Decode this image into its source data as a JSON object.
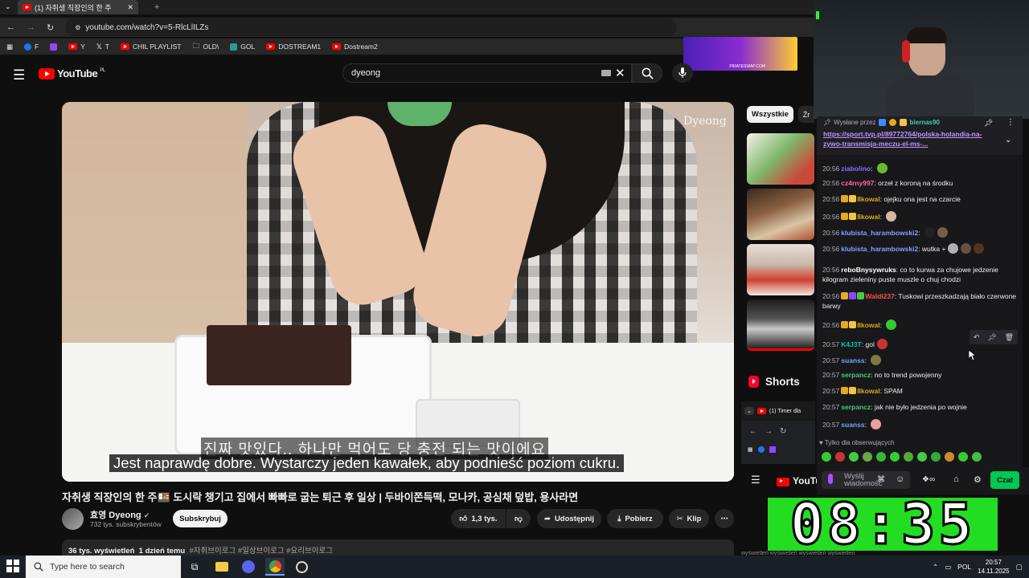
{
  "browser": {
    "tab_title": "(1) 자취생 직장인의 한 주",
    "url": "youtube.com/watch?v=5-RlcLlILZs",
    "bookmarks": [
      {
        "label": "F",
        "color": "#1877f2"
      },
      {
        "label": "",
        "color": "#9146ff"
      },
      {
        "label": "Y",
        "color": "#ff0000"
      },
      {
        "label": "T",
        "color": "#ffffff"
      },
      {
        "label": "CHIL PLAYLIST",
        "color": "#ff0000"
      },
      {
        "label": "OLD\\",
        "color": "#e3e3e3"
      },
      {
        "label": "GOL",
        "color": "#2a9d8f"
      },
      {
        "label": "DOSTREAM1",
        "color": "#ff0000"
      },
      {
        "label": "Dostream2",
        "color": "#ff0000"
      }
    ],
    "ad_text": "PIRATESWAP.COM"
  },
  "youtube": {
    "logo_text": "YouTube",
    "region": "PL",
    "search_value": "dyeong",
    "video": {
      "watermark": "Dyeong",
      "subtitle_ko": "진짜 맛있다.. 하나만 먹어도 당 충전 되는 맛이에요",
      "subtitle_pl": "Jest naprawdę dobre. Wystarczy jeden kawałek, aby podnieść poziom cukru.",
      "title": "자취생 직장인의 한 주🍱 도시락 챙기고 집에서 빠빠로 굽는 퇴근 후 일상 | 두바이쫀득떡, 모나카, 공심채 덮밥, 용사라면",
      "channel": "효영 Dyeong",
      "subscribers": "732 tys. subskrybentów",
      "subscribe_label": "Subskrybuj",
      "likes": "1,3 tys.",
      "share_label": "Udostępnij",
      "download_label": "Pobierz",
      "clip_label": "Klip",
      "views": "36 tys. wyświetleń",
      "date": "1 dzień temu",
      "hashtags": "#자취브이로그 #일상브이로그 #요리브이로그"
    },
    "chips": [
      "Wszystkie",
      "Źr"
    ],
    "shorts_label": "Shorts",
    "mini_tab": "(1) Timer dla"
  },
  "chat": {
    "pinned_by_prefix": "Wysłane przez",
    "pinned_by_user": "biernas90",
    "pinned_link": "https://sport.tvp.pl/89772764/polska-holandia-na-zywo-transmisja-meczu-el-ms-...",
    "messages": [
      {
        "time": "20:56",
        "user": "ziabolino",
        "color": "#8a6cff",
        "text": "",
        "badges": [],
        "emotes": [
          "#66bb33"
        ]
      },
      {
        "time": "20:56",
        "user": "cz4rny997",
        "color": "#ff6699",
        "text": "orzeł z koroną na środku",
        "badges": [],
        "emotes": []
      },
      {
        "time": "20:56",
        "user": "8kowal",
        "color": "#daa520",
        "text": "ojejku ona jest na czarcie",
        "badges": [
          "#e5a823",
          "#f4c542"
        ],
        "emotes": []
      },
      {
        "time": "20:56",
        "user": "8kowal",
        "color": "#daa520",
        "text": "",
        "badges": [
          "#e5a823",
          "#f4c542"
        ],
        "emotes": [
          "#d9b8a0"
        ]
      },
      {
        "time": "20:56",
        "user": "klubista_harambowski2",
        "color": "#8a9bff",
        "text": "",
        "badges": [],
        "emotes": [
          "#222222",
          "#7a5c4a"
        ]
      },
      {
        "time": "20:56",
        "user": "klubista_harambowski2",
        "color": "#8a9bff",
        "text": "wutka +",
        "badges": [],
        "emotes": [
          "#b0b0b0",
          "#6a5040",
          "#553322"
        ]
      },
      {
        "time": "20:56",
        "user": "reboBnysywruks",
        "color": "#ffffff",
        "text": "co to kurwa za chujowe jedzenie kilogram zieleniny puste muszle o chuj chodzi",
        "badges": [],
        "emotes": []
      },
      {
        "time": "20:56",
        "user": "Waldi237",
        "color": "#ff4f4f",
        "text": "Tuskowi przeszkadzają biało czerwone barwy",
        "badges": [
          "#e5a823",
          "#9146ff",
          "#44cc44"
        ],
        "emotes": []
      },
      {
        "time": "20:56",
        "user": "8kowal",
        "color": "#daa520",
        "text": "",
        "badges": [
          "#e5a823",
          "#f4c542"
        ],
        "emotes": [
          "#33cc33"
        ]
      },
      {
        "time": "20:57",
        "user": "K4J3T",
        "color": "#00c8a8",
        "text": "gol",
        "badges": [],
        "emotes": [
          "#cc3333"
        ]
      },
      {
        "time": "20:57",
        "user": "suanss",
        "color": "#6ba8ff",
        "text": "",
        "badges": [],
        "emotes": [
          "#7a7a44"
        ]
      },
      {
        "time": "20:57",
        "user": "serpancz",
        "color": "#44cc77",
        "text": "no to trend powojenny",
        "badges": [],
        "emotes": []
      },
      {
        "time": "20:57",
        "user": "8kowal",
        "color": "#daa520",
        "text": "SPAM",
        "badges": [
          "#e5a823",
          "#f4c542"
        ],
        "emotes": []
      },
      {
        "time": "20:57",
        "user": "serpancz",
        "color": "#44cc77",
        "text": "jak nie było jedzenia po wojnie",
        "badges": [],
        "emotes": []
      },
      {
        "time": "20:57",
        "user": "suanss",
        "color": "#6ba8ff",
        "text": "",
        "badges": [],
        "emotes": [
          "#e8a0a0"
        ]
      }
    ],
    "followers_only": "Tylko dla obserwujących",
    "input_placeholder": "Wyślij wiadomość",
    "chat_button": "Czat"
  },
  "timer": {
    "value": "08:35",
    "strip_text": "wyświetleń         wyświetleń         wyświetleń         wyświetleń"
  },
  "taskbar": {
    "search_placeholder": "Type here to search",
    "language": "POL",
    "time": "20:57",
    "date": "14.11.2025"
  }
}
